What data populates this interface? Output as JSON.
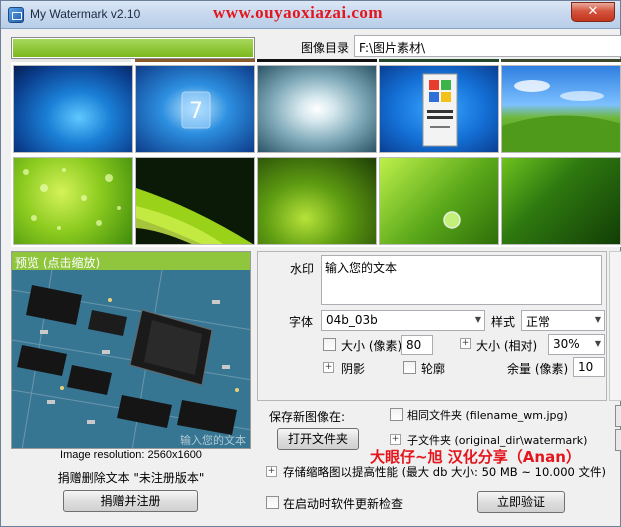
{
  "window": {
    "title": "My Watermark v2.10",
    "site_watermark": "www.ouyaoxiazai.com",
    "close_label": "✕"
  },
  "progress": {
    "fraction": 1.0,
    "color": "#7bb81c"
  },
  "directory": {
    "label": "图像目录",
    "value": "F:\\图片素材\\"
  },
  "thumbnails": [
    {
      "name": "windows-7-blue"
    },
    {
      "name": "windows-7-logo"
    },
    {
      "name": "aqua-spot"
    },
    {
      "name": "windows-nt-logo"
    },
    {
      "name": "bliss-hill"
    },
    {
      "name": "green-droplets"
    },
    {
      "name": "green-swoosh"
    },
    {
      "name": "green-glow"
    },
    {
      "name": "water-drop-leaf"
    },
    {
      "name": "dark-green"
    }
  ],
  "preview": {
    "header": "预览 (点击缩放)",
    "resolution": "Image resolution: 2560x1600",
    "overlay_text": "输入您的文本",
    "unregistered": "捐赠删除文本 \"未注册版本\"",
    "donate_button": "捐赠并注册"
  },
  "watermark": {
    "label": "水印",
    "text": "输入您的文本",
    "font_label": "字体",
    "font_value": "04b_03b",
    "style_label": "样式",
    "style_value": "正常",
    "size_px_label": "大小 (像素)",
    "size_px_value": "80",
    "size_rel_label": "大小 (相对)",
    "size_rel_value": "30%",
    "shadow_label": "阴影",
    "outline_label": "轮廓",
    "margin_label": "余量 (像素)",
    "margin_value": "10"
  },
  "save": {
    "label": "保存新图像在:",
    "open_folder": "打开文件夹",
    "same_folder": "相同文件夹 (filename_wm.jpg)",
    "subfolder": "子文件夹 (original_dir\\watermark)",
    "cache_label": "存储缩略图以提高性能 (最大 db 大小: 50 MB ~ 10.000 文件)",
    "check_updates": "在启动时软件更新检查",
    "verify_button": "立即验证"
  },
  "credit": "大眼仔~旭 汉化分享（Anan）"
}
